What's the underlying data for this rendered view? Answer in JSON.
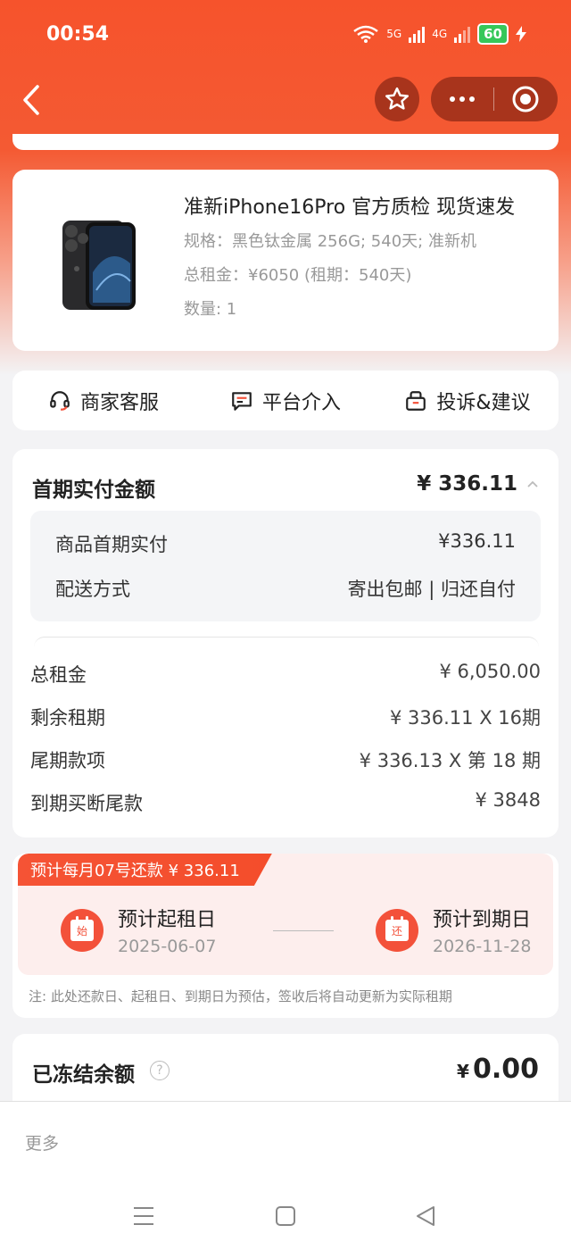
{
  "status_bar": {
    "time": "00:54",
    "network_1": "5G",
    "network_2": "4G",
    "battery": "60"
  },
  "product": {
    "title": "准新iPhone16Pro 官方质检 现货速发",
    "spec": "规格：黑色钛金属 256G; 540天; 准新机",
    "total_rent": "总租金：¥6050 (租期：540天)",
    "quantity": "数量: 1"
  },
  "services": [
    {
      "label": "商家客服",
      "icon": "headset-icon"
    },
    {
      "label": "平台介入",
      "icon": "chat-icon"
    },
    {
      "label": "投诉&建议",
      "icon": "feedback-icon"
    }
  ],
  "payment": {
    "header_label": "首期实付金额",
    "header_value": "¥ 336.11",
    "sub_rows": [
      {
        "label": "商品首期实付",
        "value": "¥336.11"
      },
      {
        "label": "配送方式",
        "value": "寄出包邮 | 归还自付"
      }
    ],
    "rows": [
      {
        "label": "总租金",
        "value": "¥ 6,050.00"
      },
      {
        "label": "剩余租期",
        "value": "¥ 336.11 X 16期"
      },
      {
        "label": "尾期款项",
        "value": "¥ 336.13 X 第 18 期"
      },
      {
        "label": "到期买断尾款",
        "value": "¥ 3848"
      }
    ]
  },
  "schedule": {
    "tag": "预计每月07号还款 ¥ 336.11",
    "start_icon_char": "始",
    "start_label": "预计起租日",
    "start_date": "2025-06-07",
    "end_icon_char": "还",
    "end_label": "预计到期日",
    "end_date": "2026-11-28",
    "note": "注: 此处还款日、起租日、到期日为预估，签收后将自动更新为实际租期"
  },
  "frozen": {
    "label": "已冻结余额",
    "currency": "¥",
    "value": "0.00"
  },
  "bottom": {
    "more": "更多"
  },
  "colors": {
    "brand": "#f6532c",
    "capsule": "#a8341c",
    "accent": "#f3513a"
  }
}
